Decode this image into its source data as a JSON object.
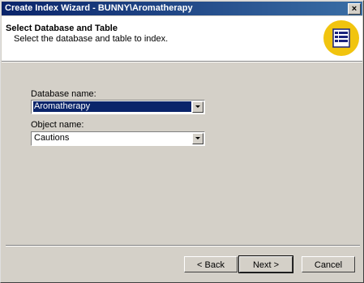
{
  "window": {
    "title": "Create Index Wizard - BUNNY\\Aromatherapy",
    "close_label": "×"
  },
  "header": {
    "title": "Select Database and Table",
    "subtitle": "Select the database and table to index."
  },
  "form": {
    "database_label": "Database name:",
    "database_value": "Aromatherapy",
    "object_label": "Object name:",
    "object_value": "Cautions"
  },
  "buttons": {
    "back": "< Back",
    "next": "Next >",
    "cancel": "Cancel"
  },
  "icons": {
    "wizard": "table-list-icon",
    "dropdown": "chevron-down-icon"
  },
  "colors": {
    "title_bar": "#0a246a",
    "selection": "#0a246a",
    "wizard_icon_bg": "#f1c40f"
  }
}
